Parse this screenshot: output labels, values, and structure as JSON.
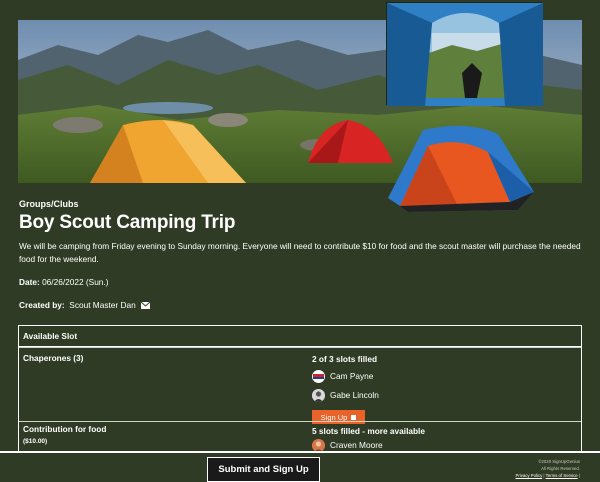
{
  "event": {
    "category": "Groups/Clubs",
    "title": "Boy Scout Camping Trip",
    "description": "We will be camping from Friday evening to Sunday morning.  Everyone will need to contribute $10 for food and the scout master will purchase the needed food for the weekend.",
    "date_label": "Date:",
    "date_value": "06/26/2022 (Sun.)",
    "created_label": "Created by:",
    "created_value": "Scout Master Dan"
  },
  "slots_table": {
    "header": "Available Slot",
    "rows": [
      {
        "name": "Chaperones (3)",
        "status": "2 of 3 slots filled",
        "people": [
          "Cam Payne",
          "Gabe Lincoln"
        ],
        "button": "Sign Up"
      },
      {
        "name": "Contribution for food",
        "sub": "($10.00)",
        "status": "5 slots filled - more available",
        "people": [
          "Craven Moore"
        ]
      }
    ]
  },
  "footer": {
    "submit_label": "Submit and Sign Up",
    "copyright": "©2020 SignUpGenius",
    "rights": "All Rights Reserved.",
    "privacy": "Privacy Policy",
    "terms": "Terms of Service",
    "sep": "|"
  },
  "colors": {
    "background": "#2f3b24",
    "button_orange": "#e8622a",
    "submit_bg": "#1a1a1a"
  },
  "icons": [
    "mail-icon",
    "avatar-icon",
    "checkbox-icon"
  ]
}
